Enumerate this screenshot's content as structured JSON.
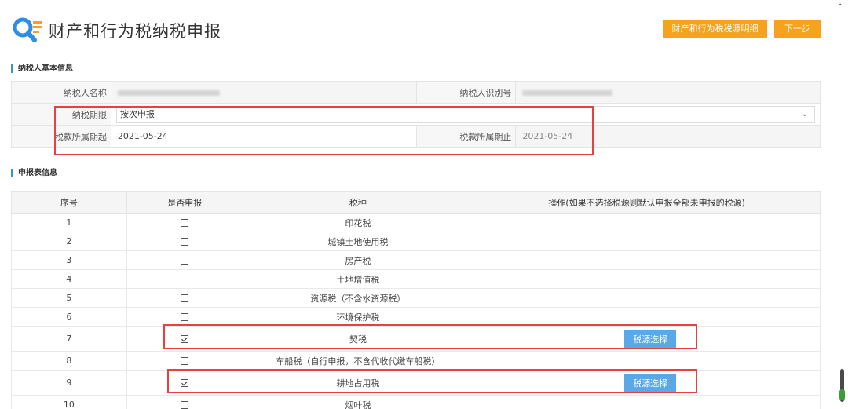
{
  "header": {
    "title": "财产和行为税纳税申报",
    "btn_detail": "财产和行为税税源明细",
    "btn_next": "下一步",
    "logo_icon": "search-document-icon",
    "accent": "#f7a21d"
  },
  "basic_info": {
    "section_title": "纳税人基本信息",
    "taxpayer_name_label": "纳税人名称",
    "taxpayer_id_label": "纳税人识别号",
    "period_label": "纳税期限",
    "period_value": "按次申报",
    "start_label": "税款所属期起",
    "start_value": "2021-05-24",
    "end_label": "税款所属期止",
    "end_value": "2021-05-24"
  },
  "report_info": {
    "section_title": "申报表信息",
    "columns": [
      "序号",
      "是否申报",
      "税种",
      "操作(如果不选择税源则默认申报全部未申报的税源)"
    ],
    "rows": [
      {
        "no": "1",
        "checked": false,
        "tax": "印花税",
        "action": ""
      },
      {
        "no": "2",
        "checked": false,
        "tax": "城镇土地使用税",
        "action": ""
      },
      {
        "no": "3",
        "checked": false,
        "tax": "房产税",
        "action": ""
      },
      {
        "no": "4",
        "checked": false,
        "tax": "土地增值税",
        "action": ""
      },
      {
        "no": "5",
        "checked": false,
        "tax": "资源税（不含水资源税）",
        "action": ""
      },
      {
        "no": "6",
        "checked": false,
        "tax": "环境保护税",
        "action": ""
      },
      {
        "no": "7",
        "checked": true,
        "tax": "契税",
        "action": "税源选择"
      },
      {
        "no": "8",
        "checked": false,
        "tax": "车船税（自行申报，不含代收代缴车船税）",
        "action": ""
      },
      {
        "no": "9",
        "checked": true,
        "tax": "耕地占用税",
        "action": "税源选择"
      },
      {
        "no": "10",
        "checked": false,
        "tax": "烟叶税",
        "action": ""
      }
    ]
  }
}
